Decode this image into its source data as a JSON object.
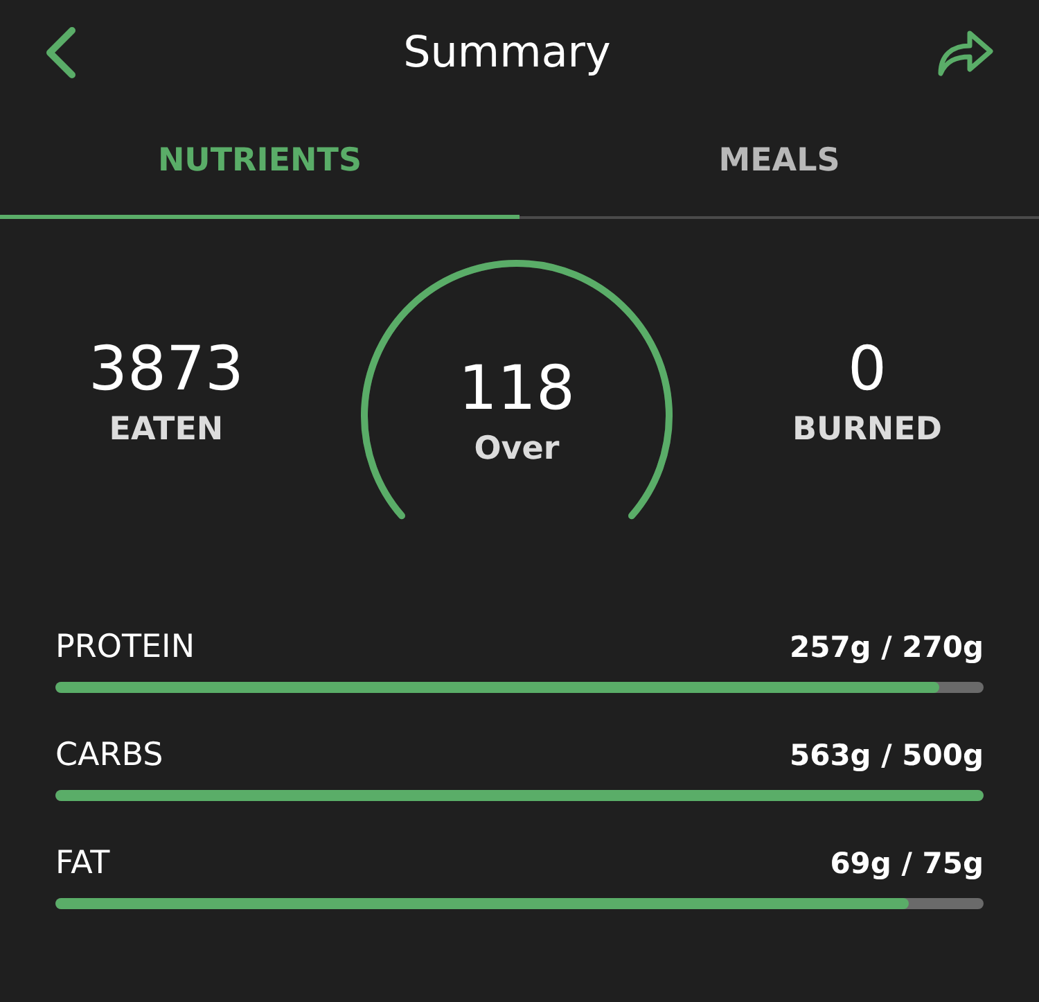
{
  "header": {
    "title": "Summary"
  },
  "tabs": [
    {
      "label": "NUTRIENTS",
      "selected": true
    },
    {
      "label": "MEALS",
      "selected": false
    }
  ],
  "calories": {
    "eaten": {
      "value": "3873",
      "label": "EATEN"
    },
    "gauge": {
      "value": "118",
      "label": "Over",
      "level": 1
    },
    "burned": {
      "value": "0",
      "label": "BURNED"
    }
  },
  "macros": [
    {
      "name": "PROTEIN",
      "reading": "257g / 270g",
      "level": 0.952
    },
    {
      "name": "CARBS",
      "reading": "563g / 500g",
      "level": 1
    },
    {
      "name": "FAT",
      "reading": "69g / 75g",
      "level": 0.92
    }
  ]
}
